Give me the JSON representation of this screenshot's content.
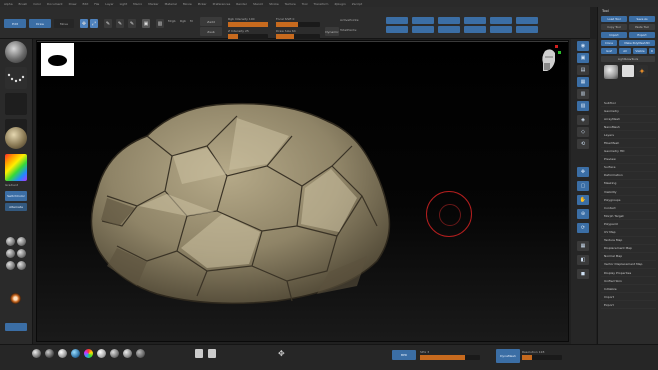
{
  "menu": {
    "items": [
      "Alpha",
      "Brush",
      "Color",
      "Document",
      "Draw",
      "Edit",
      "File",
      "Layer",
      "Light",
      "Macro",
      "Marker",
      "Material",
      "Movie",
      "Picker",
      "Preferences",
      "Render",
      "Stencil",
      "Stroke",
      "Texture",
      "Tool",
      "Transform",
      "Zplugin",
      "Zscript"
    ]
  },
  "top_shelf": {
    "buttons": [
      "Edit",
      "Draw",
      "Move",
      "Scale",
      "Rotate"
    ],
    "rgb_label": "Rgb",
    "m_label": "M",
    "mrgb_label": "Mrgb",
    "zadd_label": "Zadd",
    "zsub_label": "Zsub",
    "focal_shift_label": "Focal Shift 0",
    "draw_size_label": "Draw Size 64",
    "dynamic_label": "Dynamic",
    "z_intensity_label": "Z Intensity 25",
    "rgb_intensity_label": "Rgb Intensity 100",
    "active_points_label": "ActivePoints:",
    "total_points_label": "TotalPoints:",
    "z_intensity_value": 0.25,
    "draw_size_value": 0.4,
    "focal_value": 0.5
  },
  "left_shelf": {
    "rgb_label": "Gradient",
    "switch_label": "SwitchColor",
    "alternate_label": "Alternate",
    "texture_label": "",
    "color_accent": "#3b6ea5"
  },
  "right_panel": {
    "title": "Tool",
    "buttons": [
      "Load Tool",
      "Save As",
      "Copy Tool",
      "Paste Tool",
      "Import",
      "Export",
      "Clone",
      "Make PolyMesh3D",
      "GoZ",
      "All",
      "Visible",
      "R"
    ],
    "lightbox_label": "Lightbox▸Tools",
    "list": [
      "SubTool",
      "Geometry",
      "ArrayMesh",
      "NanoMesh",
      "Layers",
      "FiberMesh",
      "Geometry HD",
      "Preview",
      "Surface",
      "Deformation",
      "Masking",
      "Visibility",
      "Polygroups",
      "Contact",
      "Morph Target",
      "Polypaint",
      "UV Map",
      "Texture Map",
      "Displacement Map",
      "Normal Map",
      "Vector Displacement Map",
      "Display Properties",
      "Unified Skin",
      "Initialize",
      "Import",
      "Export"
    ]
  },
  "bottom_shelf": {
    "bpr_label": "BPR",
    "spix_label": "SPix 3",
    "dynamesh_label": "DynaMesh",
    "resolution_label": "Resolution 128"
  },
  "colors": {
    "accent_blue": "#3b6ea5",
    "slider_orange": "#c76a1e",
    "brush_red": "#b31e1e",
    "rock_base": "#8f8467",
    "rock_light": "#c9bfa0"
  },
  "icons": {
    "nav_head": "head-navigation-icon",
    "brush_cursor": "brush-circle-icon"
  }
}
